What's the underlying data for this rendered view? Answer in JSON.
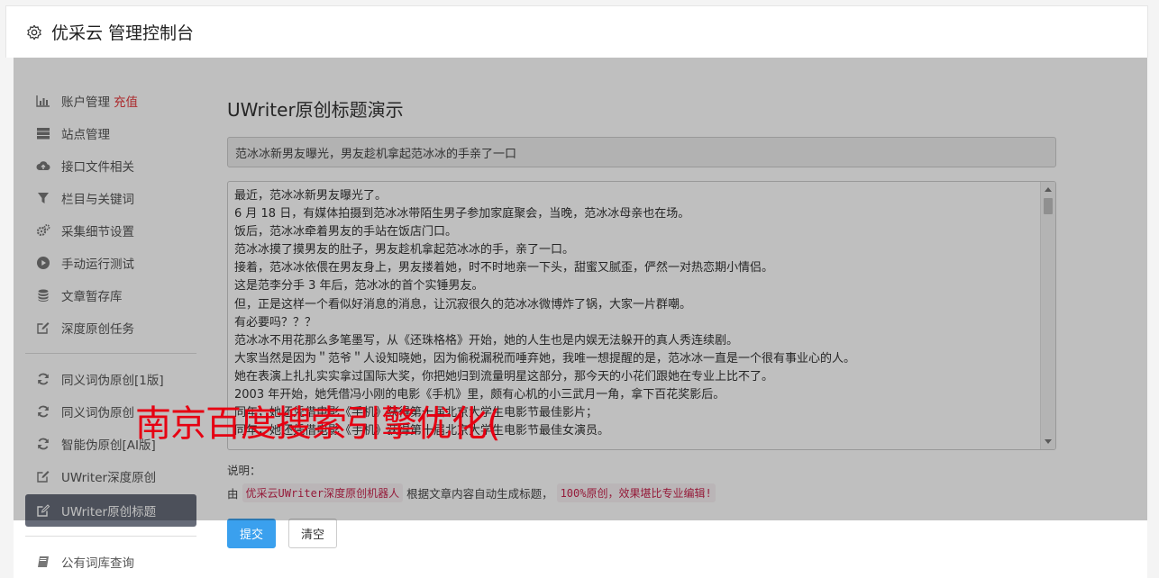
{
  "header": {
    "title": "优采云 管理控制台"
  },
  "sidebar": {
    "items": [
      {
        "label": "账户管理",
        "extra": "充值"
      },
      {
        "label": "站点管理"
      },
      {
        "label": "接口文件相关"
      },
      {
        "label": "栏目与关键词"
      },
      {
        "label": "采集细节设置"
      },
      {
        "label": "手动运行测试"
      },
      {
        "label": "文章暂存库"
      },
      {
        "label": "深度原创任务"
      },
      {
        "label": "同义词伪原创[1版]"
      },
      {
        "label": "同义词伪原创"
      },
      {
        "label": "智能伪原创[AI版]"
      },
      {
        "label": "UWriter深度原创"
      },
      {
        "label": "UWriter原创标题"
      },
      {
        "label": "公有词库查询"
      }
    ]
  },
  "main": {
    "title": "UWriter原创标题演示",
    "title_value": "范冰冰新男友曝光，男友趁机拿起范冰冰的手亲了一口",
    "content_lines": [
      "最近，范冰冰新男友曝光了。",
      "6 月 18 日，有媒体拍摄到范冰冰带陌生男子参加家庭聚会，当晚，范冰冰母亲也在场。",
      "饭后，范冰冰牵着男友的手站在饭店门口。",
      "范冰冰摸了摸男友的肚子，男友趁机拿起范冰冰的手，亲了一口。",
      "接着，范冰冰依偎在男友身上，男友搂着她，时不时地亲一下头，甜蜜又腻歪，俨然一对热恋期小情侣。",
      "这是范李分手 3 年后，范冰冰的首个实锤男友。",
      "但，正是这样一个看似好消息的消息，让沉寂很久的范冰冰微博炸了锅，大家一片群嘲。",
      "有必要吗？？？",
      "范冰冰不用花那么多笔墨写，从《还珠格格》开始，她的人生也是内娱无法躲开的真人秀连续剧。",
      "大家当然是因为＂范爷＂人设知晓她，因为偷税漏税而唾弃她，我唯一想提醒的是，范冰冰一直是一个很有事业心的人。",
      "她在表演上扎扎实实拿过国际大奖，你把她归到流量明星这部分，那今天的小花们跟她在专业上比不了。",
      "2003 年开始，她凭借冯小刚的电影《手机》里，颇有心机的小三武月一角，拿下百花奖影后。",
      "同年，她还凭借电影《手机》获得第十届北京大学生电影节最佳影片；",
      "同年，她还凭借电影《手机》获得第十届北京大学生电影节最佳女演员。"
    ],
    "explain_label": "说明：",
    "explain_prefix": "由",
    "explain_code1": "优采云UWriter深度原创机器人",
    "explain_middle": "根据文章内容自动生成标题，",
    "explain_code2": "100%原创，效果堪比专业编辑!",
    "submit_label": "提交",
    "clear_label": "清空"
  },
  "watermark": "南京百度搜索引擎优化("
}
